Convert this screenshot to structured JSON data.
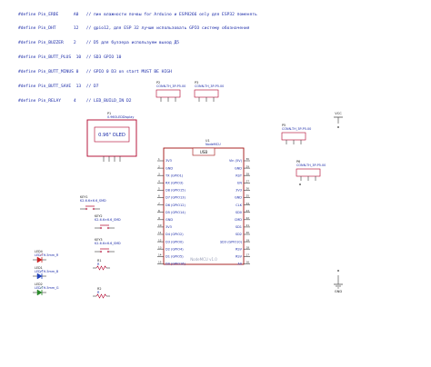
{
  "code_lines": [
    {
      "def": "#define Pin_ERDE      A0",
      "comment": "// пин влажности почвы for Arduino и ESP8266 only для ESP32 поменять"
    },
    {
      "def": "#define Pin_DHT       12",
      "comment": "// gpio12, для ESP 32 лучше использовать GPIO систему обозначения"
    },
    {
      "def": "#define Pin_BUZZER    2",
      "comment": "// D5 для буззера используем выход Д5"
    },
    {
      "def": "#define Pin_BUTT_PLUS  10",
      "comment": "// SD3 GPIO 10"
    },
    {
      "def": "#define Pin_BUTT_MINUS 0",
      "comment": "// GPIO 0 D3 on start MUST BE HIGH"
    },
    {
      "def": "#define Pin_BUTT_SAVE  13",
      "comment": "// D7"
    },
    {
      "def": "#define Pin_RELAY     4",
      "comment": "// LED_BUILD_IN D2"
    }
  ],
  "oled": {
    "ref": "P1",
    "name": "0.96OLEDDisplay",
    "screen_label": "0.96\" OLED"
  },
  "headers": [
    {
      "ref": "P2",
      "name": "CONN-TH_3P-P5.00"
    },
    {
      "ref": "P3",
      "name": "CONN-TH_3P-P5.00"
    },
    {
      "ref": "P5",
      "name": "CONN-TH_3P-P5.00"
    },
    {
      "ref": "P6",
      "name": "CONN-TH_3P-P5.00"
    }
  ],
  "mcu": {
    "ref": "U1",
    "name": "NodeMCU",
    "usb_label": "USB",
    "bottom_label": "NodeMCU v1.0",
    "left_pins": [
      {
        "num": "1",
        "name": "3V3"
      },
      {
        "num": "2",
        "name": "GND"
      },
      {
        "num": "3",
        "name": "TX (GPIO1)"
      },
      {
        "num": "4",
        "name": "RX (GPIO3)"
      },
      {
        "num": "5",
        "name": "D8 (GPIO15)"
      },
      {
        "num": "6",
        "name": "D7 (GPIO13)"
      },
      {
        "num": "7",
        "name": "D6 (GPIO12)"
      },
      {
        "num": "8",
        "name": "D5 (GPIO14)"
      },
      {
        "num": "9",
        "name": "GND"
      },
      {
        "num": "10",
        "name": "3V3"
      },
      {
        "num": "11",
        "name": "D4 (GPIO2)"
      },
      {
        "num": "12",
        "name": "D3 (GPIO0)"
      },
      {
        "num": "13",
        "name": "D2 (GPIO4)"
      },
      {
        "num": "14",
        "name": "D1 (GPIO5)"
      },
      {
        "num": "15",
        "name": "D0 (GPIO16)"
      }
    ],
    "right_pins": [
      {
        "num": "30",
        "name": "Vin (5V)"
      },
      {
        "num": "29",
        "name": "GND"
      },
      {
        "num": "28",
        "name": "RST"
      },
      {
        "num": "27",
        "name": "EN"
      },
      {
        "num": "26",
        "name": "3V3"
      },
      {
        "num": "25",
        "name": "GND"
      },
      {
        "num": "24",
        "name": "CLK"
      },
      {
        "num": "23",
        "name": "SD0"
      },
      {
        "num": "22",
        "name": "CMD"
      },
      {
        "num": "21",
        "name": "SD1"
      },
      {
        "num": "20",
        "name": "SD2"
      },
      {
        "num": "19",
        "name": "SD3 (GPIO10)"
      },
      {
        "num": "18",
        "name": "RSV"
      },
      {
        "num": "17",
        "name": "RSV"
      },
      {
        "num": "16",
        "name": "A0"
      }
    ]
  },
  "keys": [
    {
      "ref": "KEY1",
      "name": "K2-6.6×6.6_SMD"
    },
    {
      "ref": "KEY2",
      "name": "K2-6.6×6.6_SMD"
    },
    {
      "ref": "KEY3",
      "name": "K2-6.6×6.6_SMD"
    }
  ],
  "leds": [
    {
      "ref": "LED4",
      "name": "LED-TH-5mm_R"
    },
    {
      "ref": "LED1",
      "name": "LED-TH-5mm_B"
    },
    {
      "ref": "LED2",
      "name": "LED-TH-5mm_G"
    }
  ],
  "resistors": [
    {
      "ref": "R1",
      "value": "R"
    },
    {
      "ref": "R2",
      "value": "R"
    }
  ],
  "power": {
    "vcc_label": "VCC",
    "gnd_label": "GND"
  },
  "colors": {
    "symbol_outline": "#b0002a",
    "pin_line": "#3a3a3a",
    "label_text": "#1a2aa8",
    "ref_text": "#222222",
    "mcu_outline": "#a01010",
    "led_red": "#cc2222",
    "led_blue": "#2244bb",
    "led_green": "#2a8a2a"
  }
}
